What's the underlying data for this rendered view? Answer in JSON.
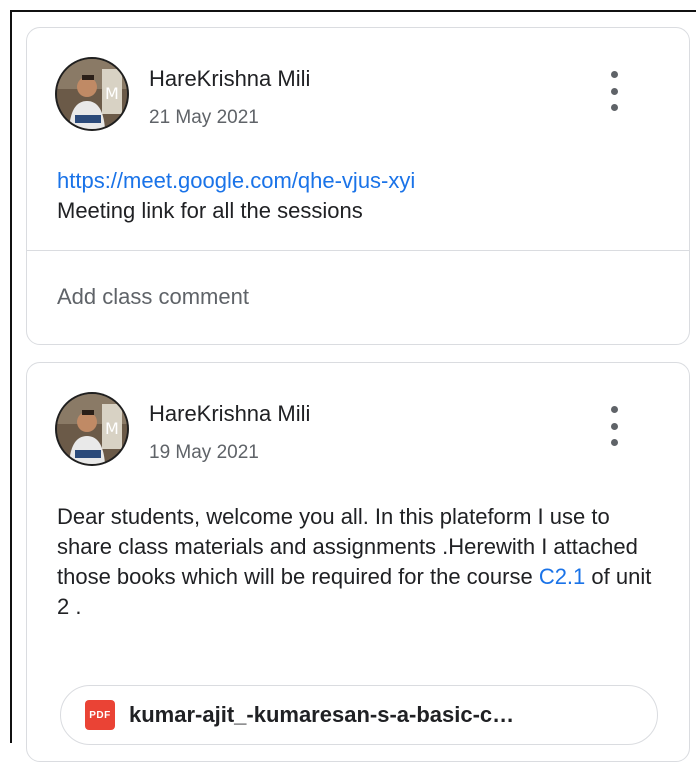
{
  "posts": [
    {
      "author": "HareKrishna Mili",
      "date": "21 May 2021",
      "link_text": "https://meet.google.com/qhe-vjus-xyi",
      "text": "Meeting link for all the sessions",
      "comment_placeholder": "Add class comment",
      "menu_icon": "more-vert-icon"
    },
    {
      "author": "HareKrishna Mili",
      "date": "19 May 2021",
      "text_before": "Dear students, welcome you all. In this plateform I use to share class materials and assignments .Herewith I attached those books which will be required for the course ",
      "link_text": "C2.1",
      "text_after": " of unit 2 .",
      "menu_icon": "more-vert-icon",
      "attachment": {
        "icon": "pdf-icon",
        "icon_label": "PDF",
        "name": "kumar-ajit_-kumaresan-s-a-basic-c…"
      }
    }
  ],
  "colors": {
    "link": "#1a73e8",
    "secondary_text": "#5f6368",
    "border": "#dadce0",
    "pdf": "#ea4335"
  }
}
